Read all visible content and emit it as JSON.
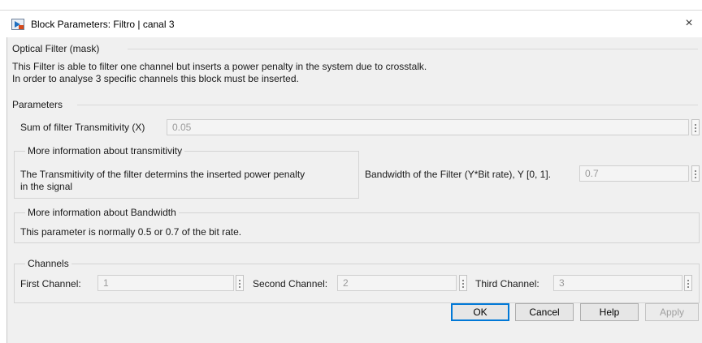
{
  "window": {
    "title": "Block Parameters: Filtro | canal 3",
    "close_glyph": "×"
  },
  "mask": {
    "header": "Optical Filter (mask)",
    "description_line1": "This Filter is able to filter one channel but inserts a power penalty in  the system due to crosstalk.",
    "description_line2": "In order to analyse 3 specific channels this block must be inserted."
  },
  "parameters": {
    "header": "Parameters",
    "transmitivity_label": "Sum of filter Transmitivity (X)",
    "transmitivity_value": "0.05",
    "info_transmitivity": {
      "header": "More information about transmitivity",
      "text_line1": "The Transmitivity of the filter determins the inserted power penalty",
      "text_line2": "in the signal"
    },
    "bandwidth_label": "Bandwidth of the Filter (Y*Bit rate), Y [0, 1].",
    "bandwidth_value": "0.7",
    "info_bandwidth": {
      "header": "More information about Bandwidth",
      "text": "This parameter is normally 0.5 or 0.7 of the bit rate."
    },
    "channels": {
      "header": "Channels",
      "first_label": "First Channel:",
      "first_value": "1",
      "second_label": "Second Channel:",
      "second_value": "2",
      "third_label": "Third Channel:",
      "third_value": "3"
    }
  },
  "buttons": {
    "ok": "OK",
    "cancel": "Cancel",
    "help": "Help",
    "apply": "Apply"
  },
  "colors": {
    "accent": "#0078d7",
    "client_bg": "#f0f0f0",
    "field_bg": "#f4f4f4"
  }
}
